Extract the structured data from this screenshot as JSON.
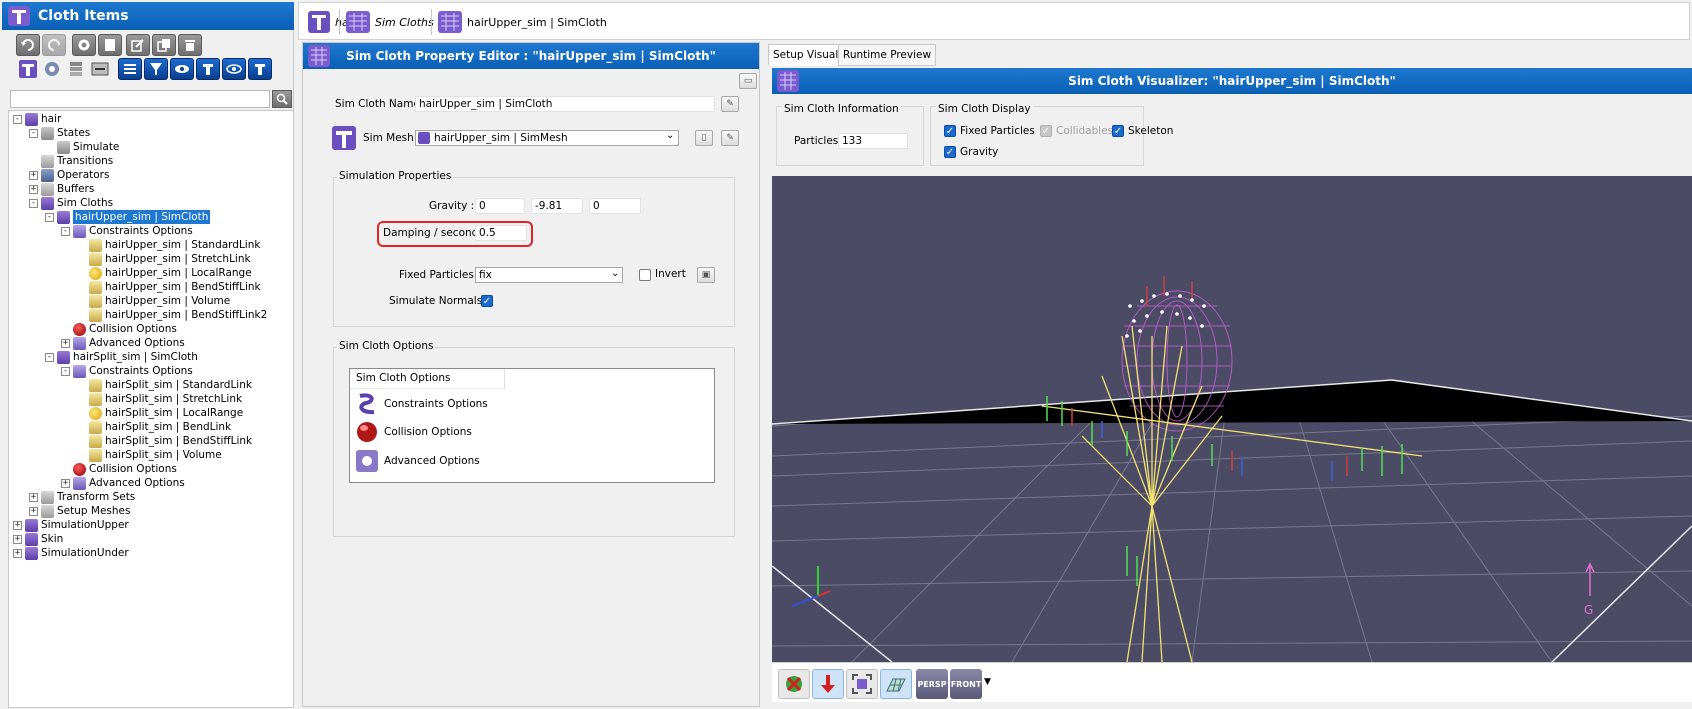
{
  "left": {
    "title": "Cloth Items",
    "tree": [
      {
        "label": "hair"
      },
      {
        "label": "States"
      },
      {
        "label": "Simulate"
      },
      {
        "label": "Transitions"
      },
      {
        "label": "Operators"
      },
      {
        "label": "Buffers"
      },
      {
        "label": "Sim Cloths"
      },
      {
        "label": "hairUpper_sim | SimCloth"
      },
      {
        "label": "Constraints Options"
      },
      {
        "label": "hairUpper_sim | StandardLink"
      },
      {
        "label": "hairUpper_sim | StretchLink"
      },
      {
        "label": "hairUpper_sim | LocalRange"
      },
      {
        "label": "hairUpper_sim | BendStiffLink"
      },
      {
        "label": "hairUpper_sim | Volume"
      },
      {
        "label": "hairUpper_sim | BendStiffLink2"
      },
      {
        "label": "Collision Options"
      },
      {
        "label": "Advanced Options"
      },
      {
        "label": "hairSplit_sim | SimCloth"
      },
      {
        "label": "Constraints Options"
      },
      {
        "label": "hairSplit_sim | StandardLink"
      },
      {
        "label": "hairSplit_sim | StretchLink"
      },
      {
        "label": "hairSplit_sim | LocalRange"
      },
      {
        "label": "hairSplit_sim | BendLink"
      },
      {
        "label": "hairSplit_sim | BendStiffLink"
      },
      {
        "label": "hairSplit_sim | Volume"
      },
      {
        "label": "Collision Options"
      },
      {
        "label": "Advanced Options"
      },
      {
        "label": "Transform Sets"
      },
      {
        "label": "Setup Meshes"
      },
      {
        "label": "SimulationUpper"
      },
      {
        "label": "Skin"
      },
      {
        "label": "SimulationUnder"
      }
    ]
  },
  "breadcrumb": [
    "hair",
    "Sim Cloths",
    "hairUpper_sim | SimCloth"
  ],
  "editor": {
    "title": "Sim Cloth Property Editor : \"hairUpper_sim | SimCloth\"",
    "name_label": "Sim Cloth Name :",
    "name_value": "hairUpper_sim | SimCloth",
    "mesh_label": "Sim Mesh :",
    "mesh_value": "hairUpper_sim | SimMesh",
    "sim_props_group": "Simulation Properties",
    "gravity_label": "Gravity :",
    "gravity_x": "0",
    "gravity_y": "-9.81",
    "gravity_z": "0",
    "damping_label": "Damping / second :",
    "damping_value": "0.5",
    "fixed_label": "Fixed Particles :",
    "fixed_value": "fix",
    "invert_label": "Invert",
    "normals_label": "Simulate Normals :",
    "options_group": "Sim Cloth Options",
    "options_header": "Sim Cloth Options",
    "options_items": [
      "Constraints Options",
      "Collision Options",
      "Advanced Options"
    ]
  },
  "visualizer": {
    "tabs": [
      "Setup Visualizer",
      "Runtime Preview"
    ],
    "title": "Sim Cloth Visualizer: \"hairUpper_sim | SimCloth\"",
    "info_group": "Sim Cloth Information",
    "particles_label": "Particles :",
    "particles_value": "133",
    "display_group": "Sim Cloth Display",
    "fixed_particles": "Fixed Particles",
    "collidables": "Collidables",
    "skeleton": "Skeleton",
    "gravity": "Gravity",
    "gravity_axis_label": "G",
    "persp_label": "PERSP",
    "front_label": "FRONT"
  }
}
